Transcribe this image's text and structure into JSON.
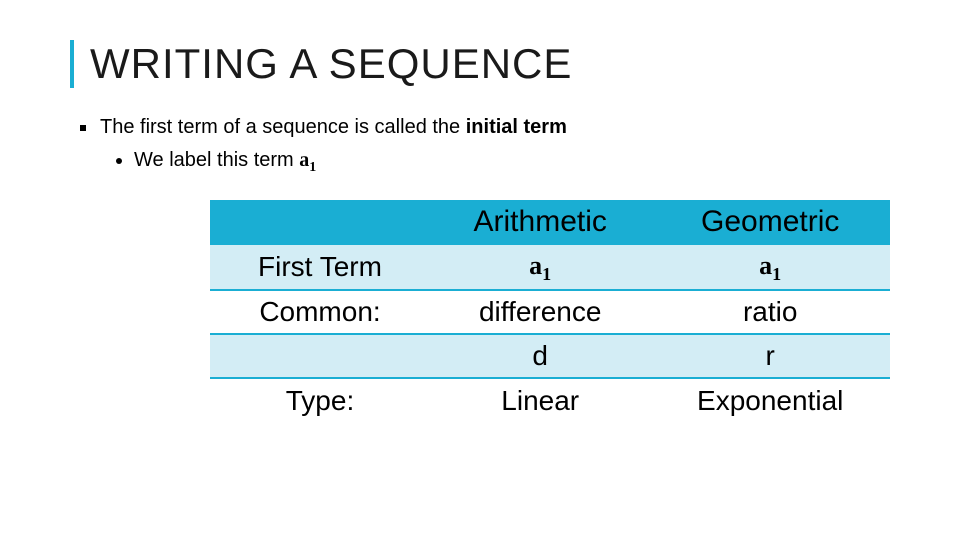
{
  "title": "WRITING A SEQUENCE",
  "bullet": {
    "line1_prefix": "The first term of a sequence is called the ",
    "line1_bold": "initial term",
    "sub_prefix": "We label this term ",
    "sub_math_a": "a",
    "sub_math_1": "1"
  },
  "table": {
    "headers": {
      "blank": "",
      "col1": "Arithmetic",
      "col2": "Geometric"
    },
    "rows": [
      {
        "label": "First Term",
        "col1_math": true,
        "col2_math": true
      },
      {
        "label": "Common:",
        "col1": "difference",
        "col2": "ratio"
      },
      {
        "label": "",
        "col1": "d",
        "col2": "r"
      },
      {
        "label": "Type:",
        "col1": "Linear",
        "col2": "Exponential"
      }
    ],
    "math": {
      "a": "a",
      "one": "1"
    }
  }
}
